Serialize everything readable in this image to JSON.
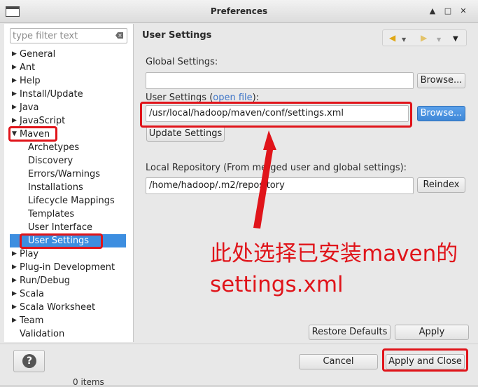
{
  "window": {
    "title": "Preferences",
    "controls": [
      "▲",
      "□",
      "✕"
    ]
  },
  "filter": {
    "placeholder": "type filter text",
    "value": ""
  },
  "tree": {
    "items": [
      {
        "label": "General",
        "expanded": false
      },
      {
        "label": "Ant",
        "expanded": false
      },
      {
        "label": "Help",
        "expanded": false
      },
      {
        "label": "Install/Update",
        "expanded": false
      },
      {
        "label": "Java",
        "expanded": false
      },
      {
        "label": "JavaScript",
        "expanded": false
      },
      {
        "label": "Maven",
        "expanded": true
      },
      {
        "label": "Archetypes",
        "child": true
      },
      {
        "label": "Discovery",
        "child": true
      },
      {
        "label": "Errors/Warnings",
        "child": true
      },
      {
        "label": "Installations",
        "child": true
      },
      {
        "label": "Lifecycle Mappings",
        "child": true
      },
      {
        "label": "Templates",
        "child": true
      },
      {
        "label": "User Interface",
        "child": true
      },
      {
        "label": "User Settings",
        "child": true,
        "selected": true
      },
      {
        "label": "Play",
        "expanded": false
      },
      {
        "label": "Plug-in Development",
        "expanded": false
      },
      {
        "label": "Run/Debug",
        "expanded": false
      },
      {
        "label": "Scala",
        "expanded": false
      },
      {
        "label": "Scala Worksheet",
        "expanded": false
      },
      {
        "label": "Team",
        "expanded": false
      },
      {
        "label": "Validation",
        "leaf": true
      }
    ]
  },
  "page": {
    "title": "User Settings",
    "global_settings_label": "Global Settings:",
    "global_settings_value": "",
    "user_settings_label_pre": "User Settings (",
    "user_settings_link": "open file",
    "user_settings_label_post": "):",
    "user_settings_value": "/usr/local/hadoop/maven/conf/settings.xml",
    "update_settings": "Update Settings",
    "local_repo_label": "Local Repository (From merged user and global settings):",
    "local_repo_value": "/home/hadoop/.m2/repository",
    "browse_global": "Browse...",
    "browse_user": "Browse...",
    "reindex": "Reindex",
    "restore_defaults": "Restore Defaults",
    "apply": "Apply"
  },
  "footer": {
    "help": "?",
    "cancel": "Cancel",
    "apply_close": "Apply and Close",
    "status": "0 items"
  },
  "annotation": {
    "line1": "此处选择已安装maven的",
    "line2": "settings.xml",
    "color": "#e0141a"
  },
  "colors": {
    "selection": "#3d8ee0",
    "link": "#3d74c7",
    "nav_back": "#e0a816"
  },
  "nav": {
    "back_icon": "◀",
    "forward_icon": "▶",
    "dropdown_icon": "▼",
    "menu_icon": "▼"
  }
}
